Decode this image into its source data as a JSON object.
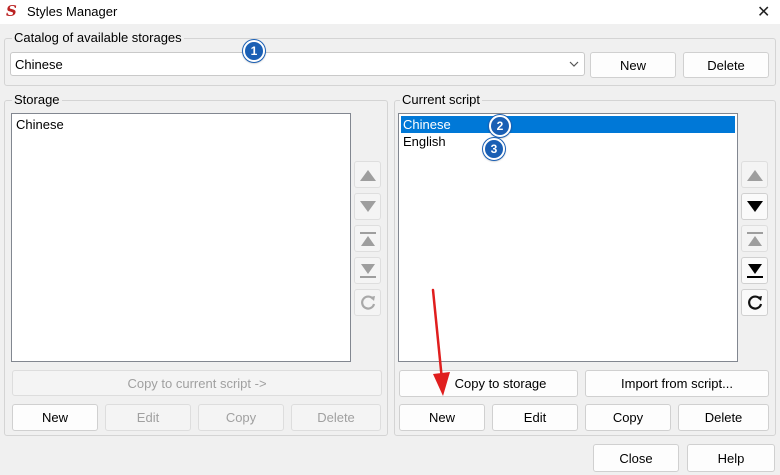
{
  "window": {
    "title": "Styles Manager",
    "icon": "styles-manager-app-icon"
  },
  "catalog": {
    "label": "Catalog of available storages",
    "selected": "Chinese",
    "new_label": "New",
    "delete_label": "Delete"
  },
  "storage": {
    "label": "Storage",
    "items": [
      "Chinese"
    ],
    "copy_label": "Copy to current script ->",
    "new_label": "New",
    "edit_label": "Edit",
    "copy_btn_label": "Copy",
    "delete_label": "Delete"
  },
  "current_script": {
    "label": "Current script",
    "items": [
      "Chinese",
      "English"
    ],
    "selected_index": 0,
    "copy_label": "Copy to storage",
    "import_label": "Import from script...",
    "new_label": "New",
    "edit_label": "Edit",
    "copy_btn_label": "Copy",
    "delete_label": "Delete"
  },
  "footer": {
    "close_label": "Close",
    "help_label": "Help"
  },
  "badges": [
    "1",
    "2",
    "3"
  ],
  "colors": {
    "selection": "#0078d7",
    "badge": "#1a5fb4",
    "arrow": "#e01e1e"
  }
}
